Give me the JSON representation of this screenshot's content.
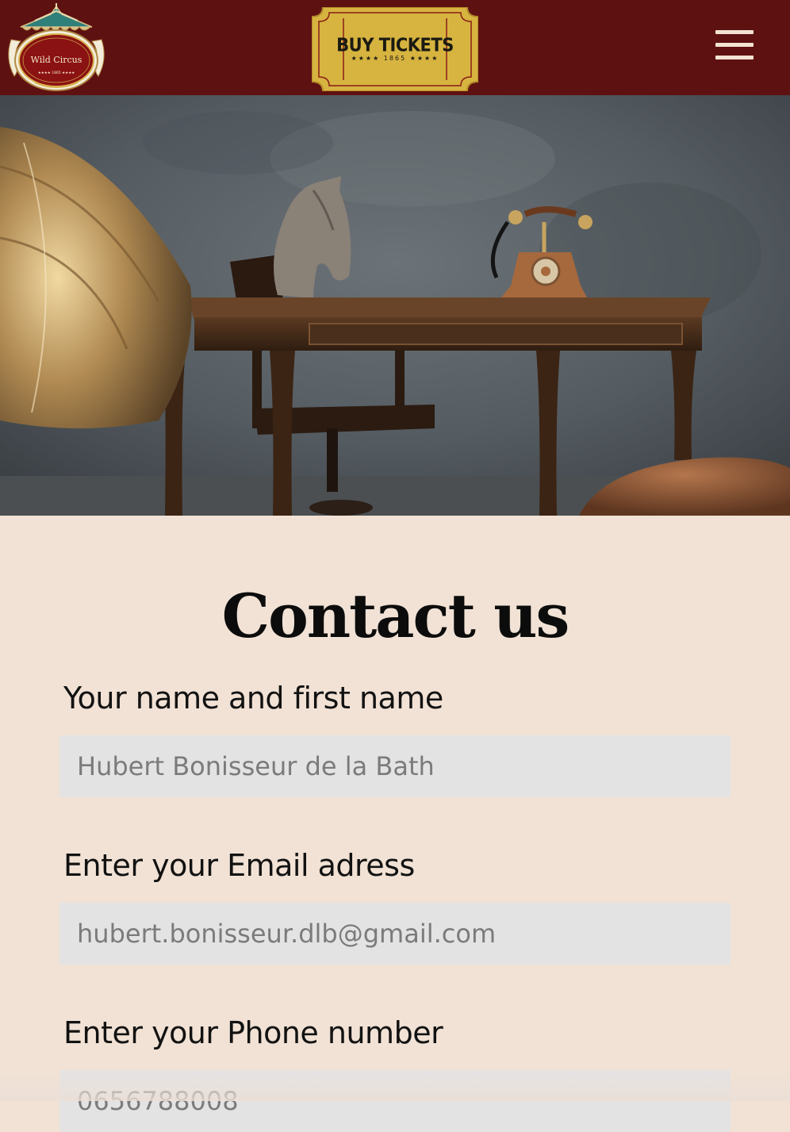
{
  "header": {
    "logo": {
      "name": "Wild Circus",
      "year": "1865"
    },
    "ticket": {
      "label": "BUY TICKETS",
      "sub": "★★★★  1865  ★★★★"
    },
    "menu_icon": "hamburger-menu-icon"
  },
  "hero": {
    "image": "vintage desk with horse bust, rotary telephone and gramophone"
  },
  "contact": {
    "title": "Contact us",
    "fields": [
      {
        "label": "Your name and first name",
        "placeholder": "Hubert Bonisseur de la Bath"
      },
      {
        "label": "Enter your Email adress",
        "placeholder": "hubert.bonisseur.dlb@gmail.com"
      },
      {
        "label": "Enter your Phone number",
        "placeholder": "0656788008"
      }
    ]
  },
  "colors": {
    "header_bg": "#5e1111",
    "page_bg": "#f1e2d5",
    "field_bg": "#e4e3e3",
    "ticket_gold": "#d9b43f"
  }
}
